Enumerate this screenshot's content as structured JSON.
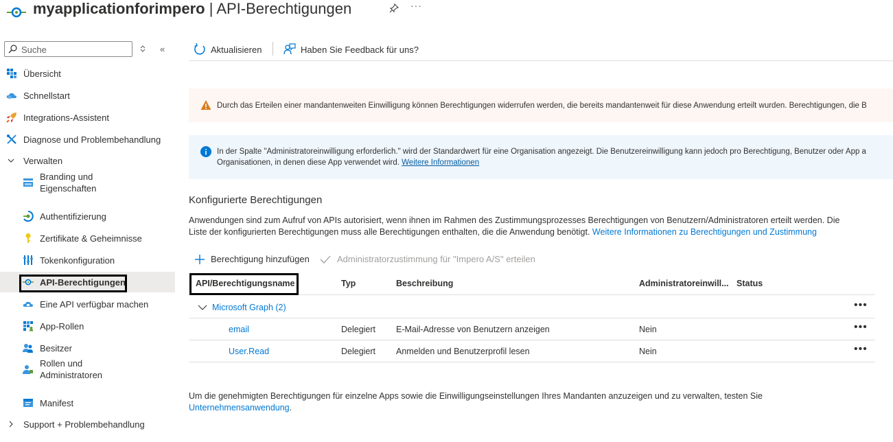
{
  "header": {
    "title_bold": "myapplicationforimpero",
    "title_rest": " | API-Berechtigungen"
  },
  "sidebar": {
    "search_placeholder": "Suche",
    "items": [
      {
        "label": "Übersicht",
        "icon": "grid-icon"
      },
      {
        "label": "Schnellstart",
        "icon": "cloud-icon"
      },
      {
        "label": "Integrations-Assistent",
        "icon": "rocket-icon"
      },
      {
        "label": "Diagnose und Problembehandlung",
        "icon": "wrench-icon"
      },
      {
        "label": "Verwalten",
        "icon": "chevron-down-icon"
      },
      {
        "label_line1": "Branding und",
        "label_line2": "Eigenschaften",
        "icon": "branding-icon"
      },
      {
        "label": "Authentifizierung",
        "icon": "auth-icon"
      },
      {
        "label": "Zertifikate & Geheimnisse",
        "icon": "key-icon"
      },
      {
        "label": "Tokenkonfiguration",
        "icon": "token-icon"
      },
      {
        "label": "API-Berechtigungen",
        "icon": "api-icon"
      },
      {
        "label": "Eine API verfügbar machen",
        "icon": "cloud-api-icon"
      },
      {
        "label": "App-Rollen",
        "icon": "app-roles-icon"
      },
      {
        "label": "Besitzer",
        "icon": "owners-icon"
      },
      {
        "label_line1": "Rollen und",
        "label_line2": "Administratoren",
        "icon": "roles-icon"
      },
      {
        "label": "Manifest",
        "icon": "manifest-icon"
      },
      {
        "label": "Support + Problembehandlung",
        "icon": "chevron-right-icon"
      }
    ]
  },
  "toolbar": {
    "refresh_label": "Aktualisieren",
    "feedback_label": "Haben Sie Feedback für uns?"
  },
  "banners": {
    "warning_text": "Durch das Erteilen einer mandantenweiten Einwilligung können Berechtigungen widerrufen werden, die bereits mandantenweit für diese Anwendung erteilt wurden. Berechtigungen, die B",
    "info_line1": "In der Spalte \"Administratoreinwilligung erforderlich.\" wird der Standardwert für eine Organisation angezeigt. Die Benutzereinwilligung kann jedoch pro Berechtigung, Benutzer oder App a",
    "info_line2": "Organisationen, in denen diese App verwendet wird.",
    "info_link": "Weitere Informationen"
  },
  "section": {
    "title": "Konfigurierte Berechtigungen",
    "desc_line1": "Anwendungen sind zum Aufruf von APIs autorisiert, wenn ihnen im Rahmen des Zustimmungsprozesses Berechtigungen von Benutzern/Administratoren erteilt werden. Die",
    "desc_line2": "Liste der konfigurierten Berechtigungen muss alle Berechtigungen enthalten, die die Anwendung benötigt.",
    "desc_link": "Weitere Informationen zu Berechtigungen und Zustimmung",
    "add_permission": "Berechtigung hinzufügen",
    "grant_consent": "Administratorzustimmung für \"Impero A/S\" erteilen"
  },
  "table": {
    "headers": [
      "API/Berechtigungsname",
      "Typ",
      "Beschreibung",
      "Administratoreinwill...",
      "Status"
    ],
    "group": "Microsoft Graph (2)",
    "rows": [
      {
        "name": "email",
        "type": "Delegiert",
        "description": "E-Mail-Adresse von Benutzern anzeigen",
        "admin": "Nein",
        "status": ""
      },
      {
        "name": "User.Read",
        "type": "Delegiert",
        "description": "Anmelden und Benutzerprofil lesen",
        "admin": "Nein",
        "status": ""
      }
    ],
    "more": "•••"
  },
  "footer": {
    "text": "Um die genehmigten Berechtigungen für einzelne Apps sowie die Einwilligungseinstellungen Ihres Mandanten anzuzeigen und zu verwalten, testen Sie",
    "link": "Unternehmensanwendung",
    "end": "."
  },
  "colors": {
    "accent": "#0078d4",
    "warning_bg": "#fdf6f3",
    "info_bg": "#eff6fc",
    "warning_icon": "#d97d1f"
  }
}
